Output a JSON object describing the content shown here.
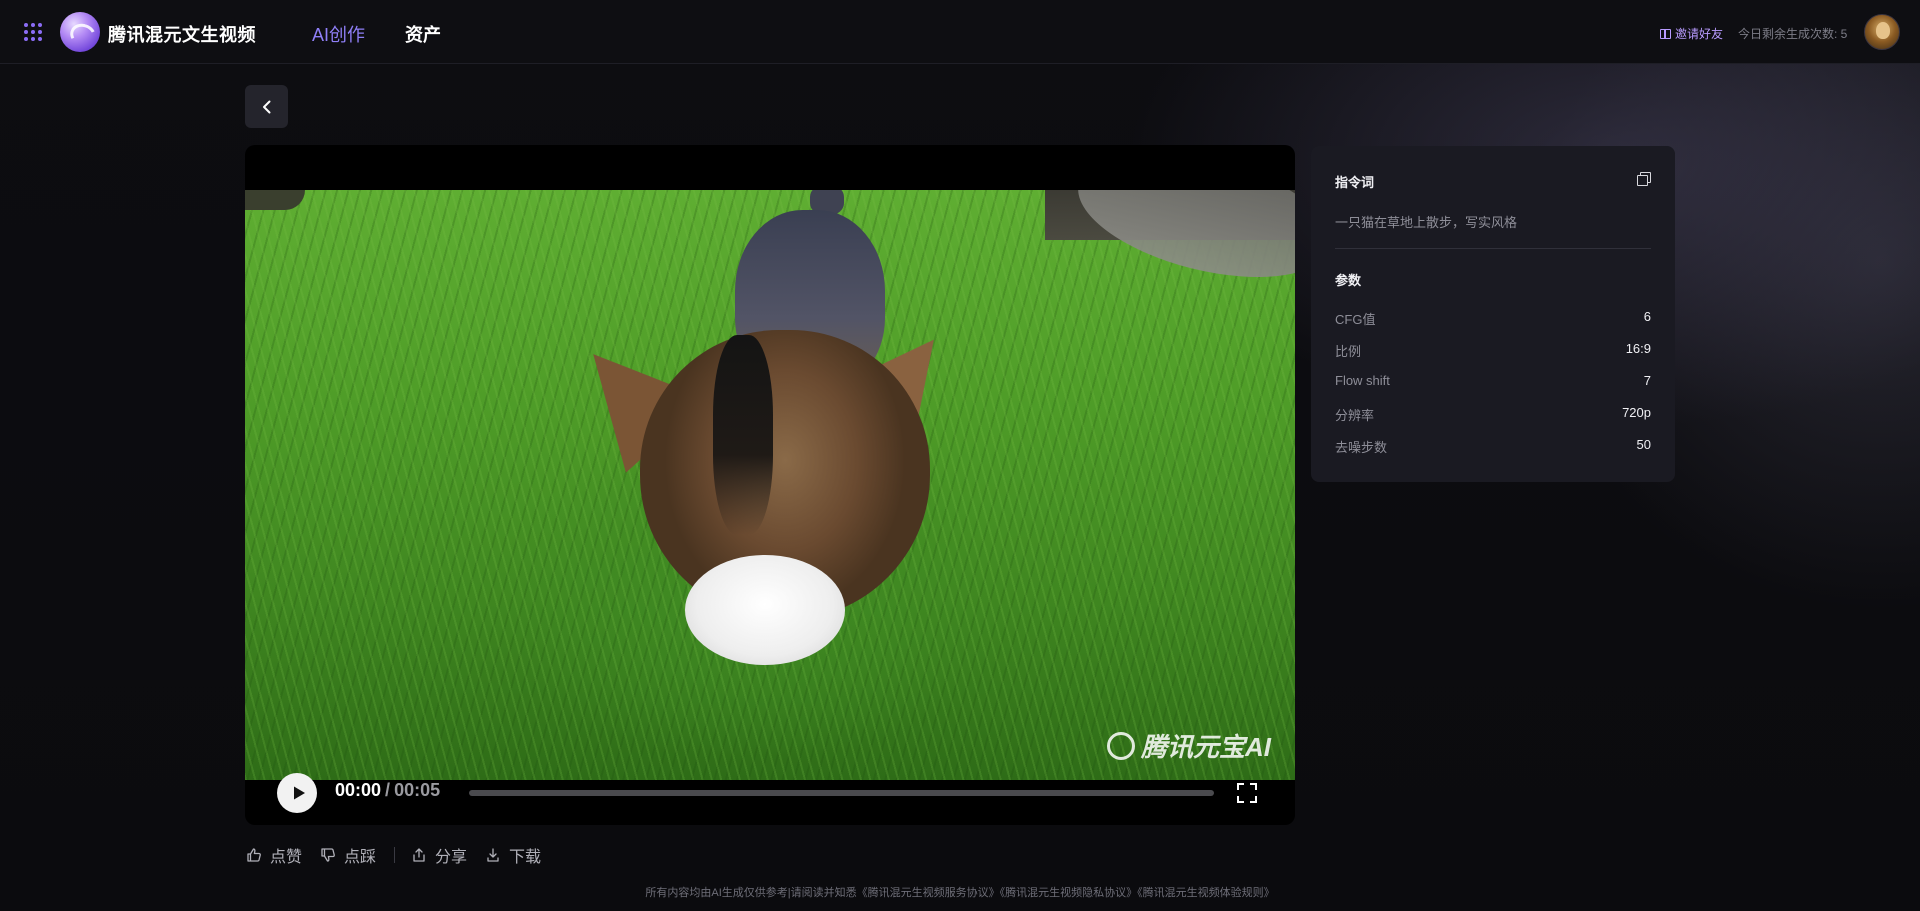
{
  "header": {
    "brand": "腾讯混元文生视频",
    "nav": {
      "ai_create": "AI创作",
      "assets": "资产"
    },
    "invite": "邀请好友",
    "quota": "今日剩余生成次数: 5"
  },
  "video": {
    "current_time": "00:00",
    "separator": "/",
    "total_time": "00:05",
    "progress": 0,
    "watermark": "腾讯元宝AI"
  },
  "actions": {
    "like": "点赞",
    "dislike": "点踩",
    "share": "分享",
    "download": "下载"
  },
  "panel": {
    "prompt_title": "指令词",
    "prompt_text": "一只猫在草地上散步，写实风格",
    "params_title": "参数",
    "params": [
      {
        "label": "CFG值",
        "value": "6"
      },
      {
        "label": "比例",
        "value": "16:9"
      },
      {
        "label": "Flow shift",
        "value": "7"
      },
      {
        "label": "分辨率",
        "value": "720p"
      },
      {
        "label": "去噪步数",
        "value": "50"
      }
    ]
  },
  "footer": "所有内容均由AI生成仅供参考|请阅读并知悉《腾讯混元生视频服务协议》《腾讯混元生视频隐私协议》《腾讯混元生视频体验规则》",
  "colors": {
    "accent": "#8b6cf5",
    "invite": "#b89bff",
    "panel_bg": "#1a1a22"
  }
}
